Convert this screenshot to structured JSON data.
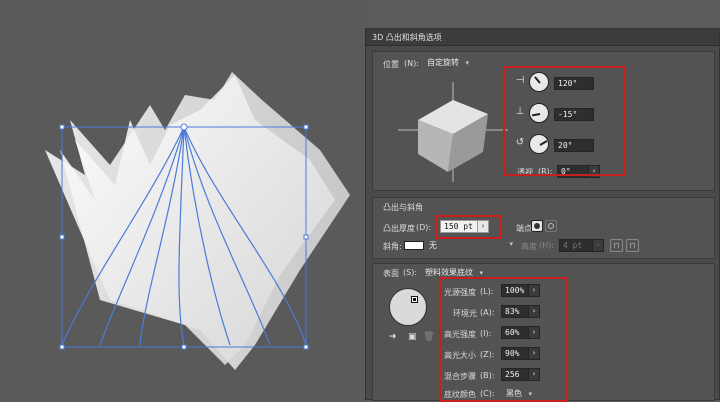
{
  "dialog": {
    "title": "3D 凸出和斜角选项",
    "position": {
      "label": "位置",
      "shortcut": "(N):",
      "value": "自定旋转"
    },
    "rotation": {
      "x": "120°",
      "y": "-15°",
      "z": "20°"
    },
    "perspective": {
      "label": "透视",
      "shortcut": "(R):",
      "value": "0°"
    },
    "extrude_section": {
      "title": "凸出与斜角"
    },
    "extrude_depth": {
      "label": "凸出厚度",
      "shortcut": "(D):",
      "value": "150 pt"
    },
    "cap": {
      "label": "端点:"
    },
    "bevel": {
      "label": "斜角:",
      "value": "无"
    },
    "height": {
      "label": "高度",
      "shortcut": "(H):",
      "value": "4 pt"
    },
    "surface": {
      "label": "表面",
      "shortcut": "(S):",
      "value": "塑料效果底纹"
    },
    "light_intensity": {
      "label": "光源强度",
      "shortcut": "(L):",
      "value": "100%"
    },
    "ambient_light": {
      "label": "环境光",
      "shortcut": "(A):",
      "value": "83%"
    },
    "highlight_intensity": {
      "label": "高光强度",
      "shortcut": "(I):",
      "value": "60%"
    },
    "highlight_size": {
      "label": "高光大小",
      "shortcut": "(Z):",
      "value": "90%"
    },
    "blend_steps": {
      "label": "混合步骤",
      "shortcut": "(B):",
      "value": "256"
    },
    "shading_color": {
      "label": "底纹颜色",
      "shortcut": "(C):",
      "value": "黑色"
    }
  },
  "icons": [
    "x-axis-rotate-icon",
    "y-axis-rotate-icon",
    "z-axis-rotate-icon",
    "chevron-down-icon",
    "arrow-right-icon",
    "cap-on-icon",
    "cap-off-icon",
    "bevel-in-icon",
    "bevel-out-icon",
    "move-light-back-icon",
    "new-light-icon",
    "delete-light-icon"
  ],
  "colors": {
    "highlight_box": "#c81e1e",
    "selection": "#4a7bd8",
    "canvas": "#5a5a5a",
    "dialog": "#4a4a4a"
  }
}
